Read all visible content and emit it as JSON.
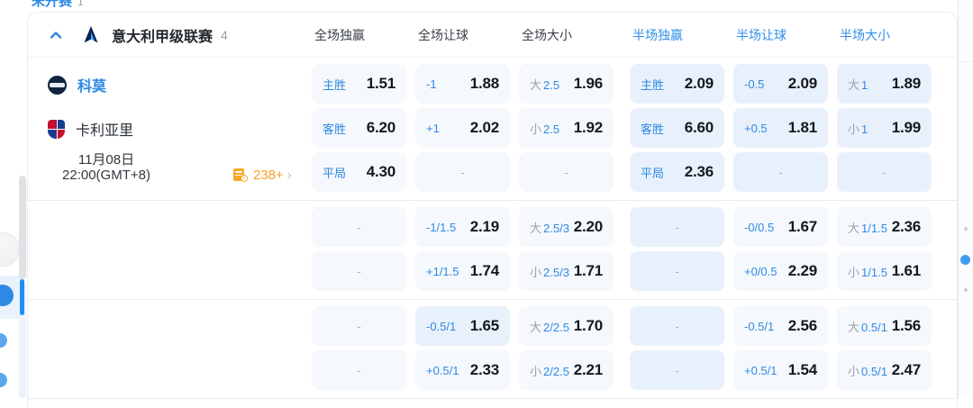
{
  "top_tab": {
    "label": "未开赛",
    "count": "1"
  },
  "league_header": {
    "league_name": "意大利甲级联赛",
    "match_count": "4",
    "columns": [
      "全场独赢",
      "全场让球",
      "全场大小",
      "半场独赢",
      "半场让球",
      "半场大小"
    ]
  },
  "match": {
    "home_team": "科莫",
    "away_team": "卡利亚里",
    "date": "11月08日",
    "time": "22:00(GMT+8)",
    "markets_count": "238+",
    "markets_chevron": "›"
  },
  "odds": {
    "dash": "-",
    "groups": [
      {
        "rows": [
          {
            "cells": [
              {
                "t": "主胜",
                "v": "1.51"
              },
              {
                "t": "-1",
                "v": "1.88"
              },
              {
                "p": "大",
                "t": "2.5",
                "v": "1.96"
              },
              {
                "t": "主胜",
                "v": "2.09",
                "tint": true
              },
              {
                "t": "-0.5",
                "v": "2.09",
                "tint": true
              },
              {
                "p": "大",
                "t": "1",
                "v": "1.89",
                "tint": true
              }
            ]
          },
          {
            "cells": [
              {
                "t": "客胜",
                "v": "6.20"
              },
              {
                "t": "+1",
                "v": "2.02"
              },
              {
                "p": "小",
                "t": "2.5",
                "v": "1.92"
              },
              {
                "t": "客胜",
                "v": "6.60",
                "tint": true
              },
              {
                "t": "+0.5",
                "v": "1.81",
                "tint": true
              },
              {
                "p": "小",
                "t": "1",
                "v": "1.99",
                "tint": true
              }
            ]
          },
          {
            "cells": [
              {
                "t": "平局",
                "v": "4.30"
              },
              {
                "dash": true
              },
              {
                "dash": true
              },
              {
                "t": "平局",
                "v": "2.36",
                "tint": true
              },
              {
                "dash": true,
                "tint": true
              },
              {
                "dash": true,
                "tint": true
              }
            ]
          }
        ]
      },
      {
        "rows": [
          {
            "cells": [
              {
                "dash": true
              },
              {
                "t": "-1/1.5",
                "v": "2.19"
              },
              {
                "p": "大",
                "t": "2.5/3",
                "v": "2.20"
              },
              {
                "dash": true,
                "tint": true
              },
              {
                "t": "-0/0.5",
                "v": "1.67"
              },
              {
                "p": "大",
                "t": "1/1.5",
                "v": "2.36"
              }
            ]
          },
          {
            "cells": [
              {
                "dash": true
              },
              {
                "t": "+1/1.5",
                "v": "1.74"
              },
              {
                "p": "小",
                "t": "2.5/3",
                "v": "1.71"
              },
              {
                "dash": true,
                "tint": true
              },
              {
                "t": "+0/0.5",
                "v": "2.29"
              },
              {
                "p": "小",
                "t": "1/1.5",
                "v": "1.61"
              }
            ]
          }
        ]
      },
      {
        "rows": [
          {
            "cells": [
              {
                "dash": true
              },
              {
                "t": "-0.5/1",
                "v": "1.65",
                "tint": true
              },
              {
                "p": "大",
                "t": "2/2.5",
                "v": "1.70"
              },
              {
                "dash": true,
                "tint": true
              },
              {
                "t": "-0.5/1",
                "v": "2.56"
              },
              {
                "p": "大",
                "t": "0.5/1",
                "v": "1.56"
              }
            ]
          },
          {
            "cells": [
              {
                "dash": true
              },
              {
                "t": "+0.5/1",
                "v": "2.33"
              },
              {
                "p": "小",
                "t": "2/2.5",
                "v": "2.21"
              },
              {
                "dash": true,
                "tint": true
              },
              {
                "t": "+0.5/1",
                "v": "1.54"
              },
              {
                "p": "小",
                "t": "0.5/1",
                "v": "2.47"
              }
            ]
          }
        ]
      }
    ]
  },
  "colors": {
    "accent": "#2e89e5",
    "half_header": "#2f8de9",
    "odds_text": "#15191e",
    "cell_bg": "#f5f8fc",
    "cell_tint": "#e8f1fb",
    "orange": "#f59d27",
    "gray_text": "#9aa1ac"
  }
}
